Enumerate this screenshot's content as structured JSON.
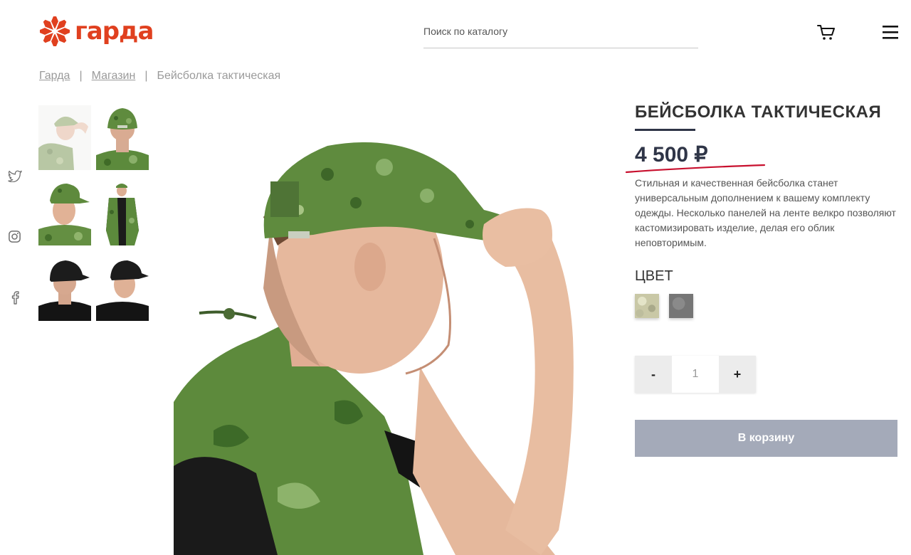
{
  "header": {
    "logo_text": "гарда",
    "search_placeholder": "Поиск по каталогу",
    "cart_icon": "cart-icon",
    "menu_icon": "hamburger-menu-icon"
  },
  "breadcrumb": {
    "items": [
      "Гарда",
      "Магазин",
      "Бейсболка тактическая"
    ],
    "separator": "|"
  },
  "social": {
    "icons": [
      "twitter-icon",
      "instagram-icon",
      "facebook-icon"
    ]
  },
  "gallery": {
    "thumbnails": [
      "cap-side-vest-camo",
      "cap-back-camo",
      "cap-front-camo",
      "full-body-vest-camo",
      "cap-back-black",
      "cap-side-black"
    ],
    "main_image": "model-side-camo-cap"
  },
  "product": {
    "title": "БЕЙСБОЛКА ТАКТИЧЕСКАЯ",
    "price": "4 500 ₽",
    "description": "Стильная и качественная бейсболка станет универсальным дополнением к вашему комплекту одежды. Несколько панелей на ленте велкро позволяют кастомизировать изделие, делая его облик неповторимым.",
    "color_label": "ЦВЕТ",
    "colors": [
      "#c9c8a6",
      "#7a7a7a"
    ],
    "quantity": {
      "minus": "-",
      "value": "1",
      "plus": "+"
    },
    "add_to_cart": "В корзину"
  },
  "colors": {
    "accent": "#e0401f",
    "dark": "#2f3547",
    "button": "#a4aab9",
    "price_mark": "#c8102e"
  }
}
